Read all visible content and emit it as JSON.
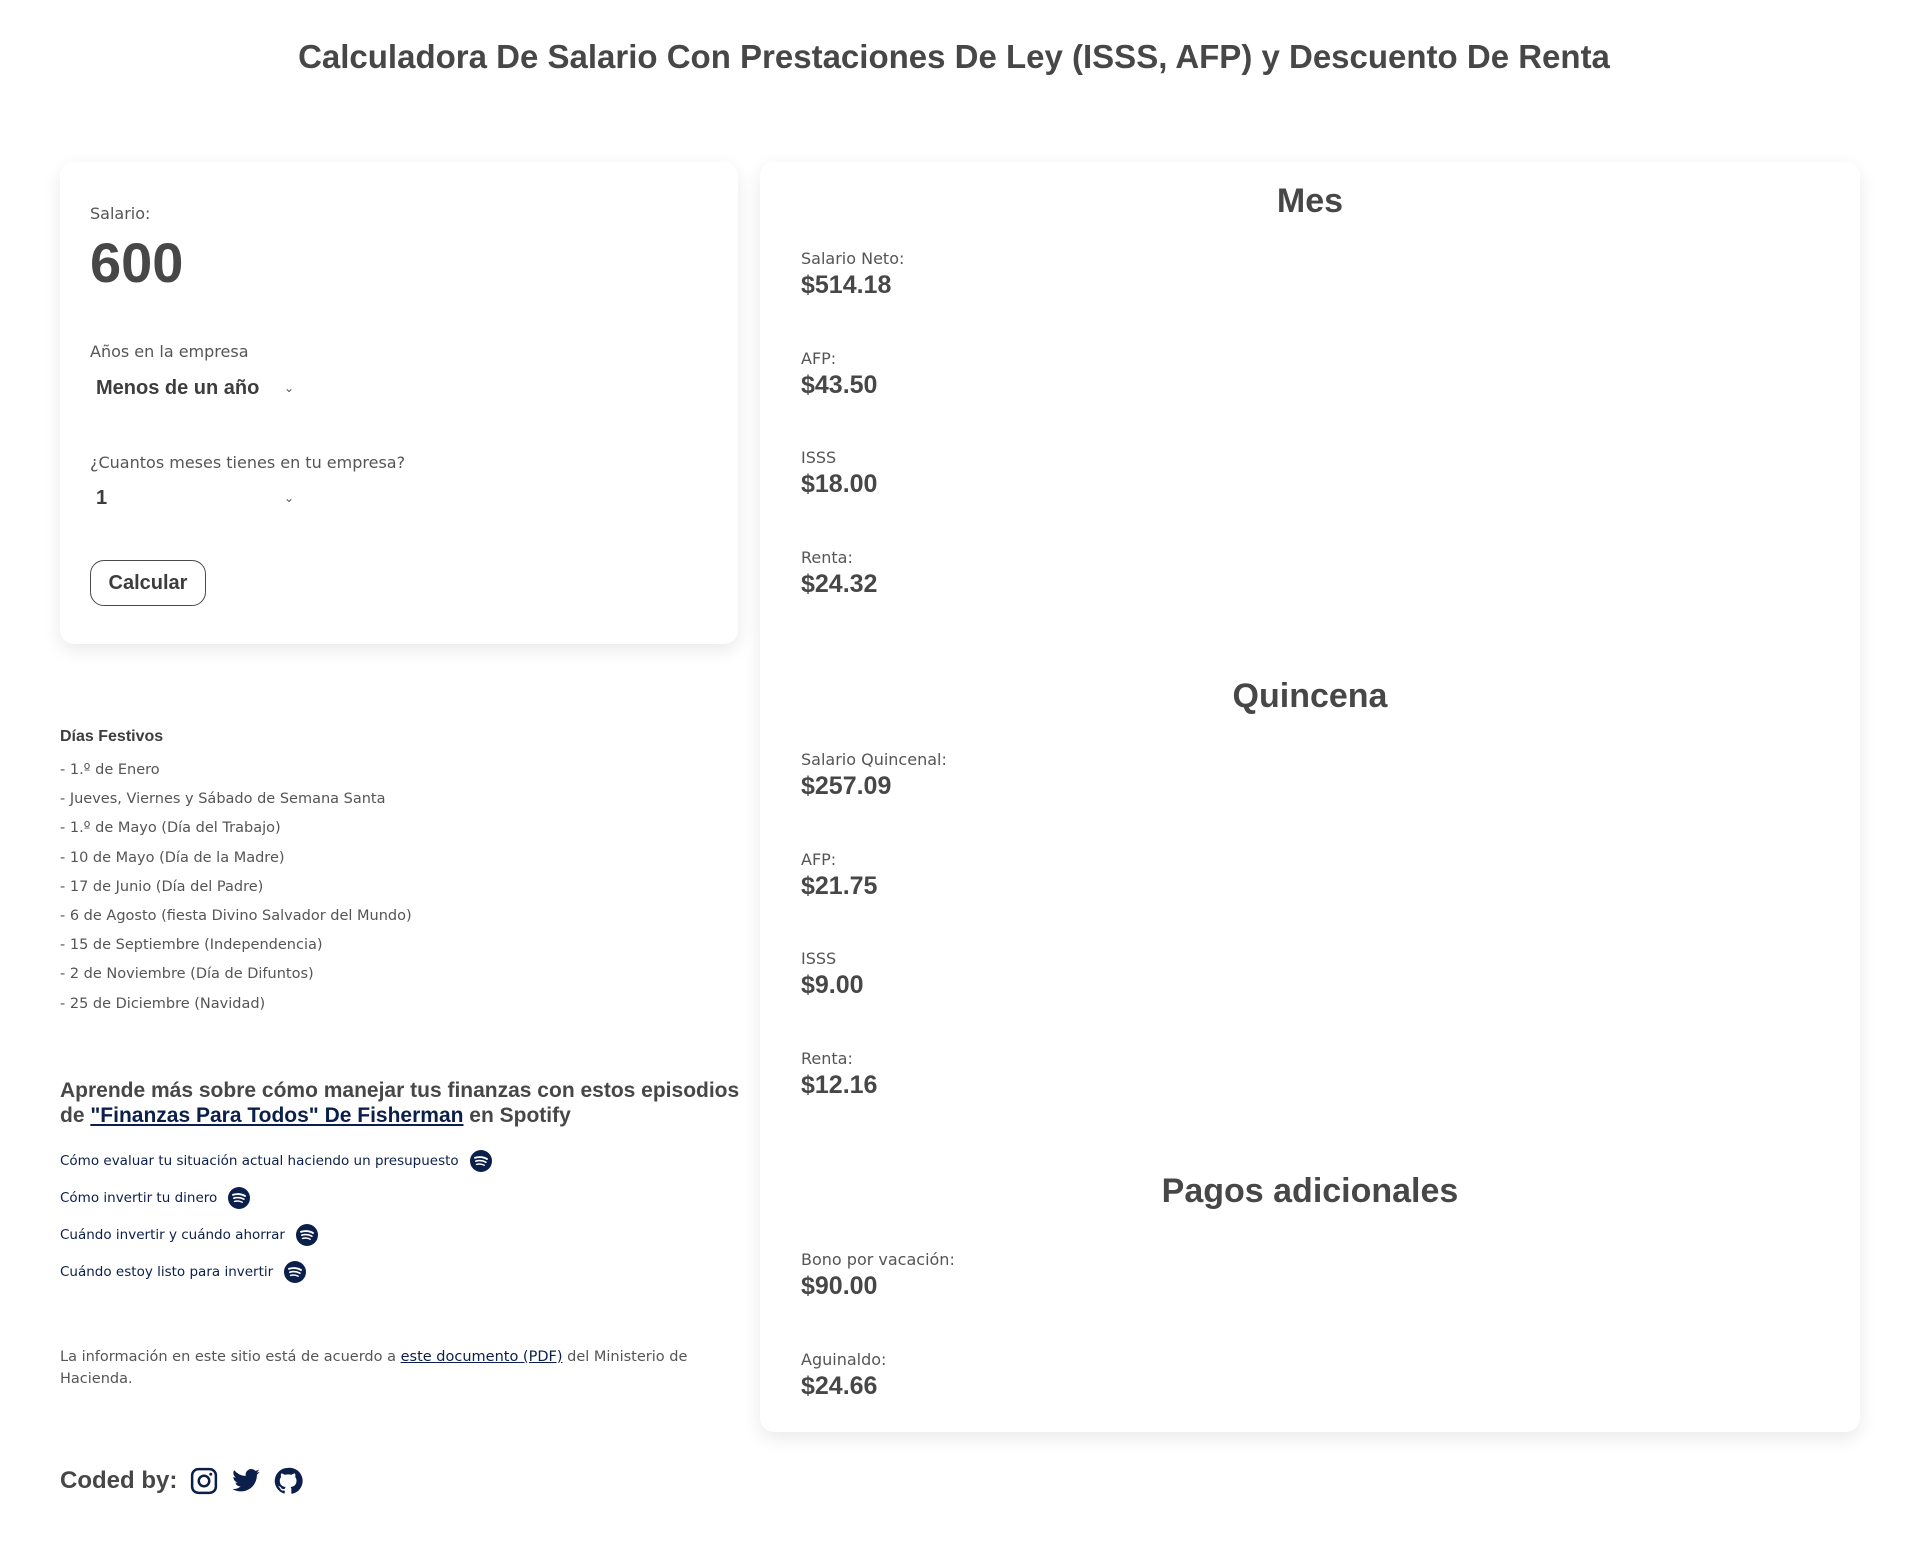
{
  "page": {
    "title": "Calculadora De Salario Con Prestaciones De Ley (ISSS, AFP) y Descuento De Renta"
  },
  "form": {
    "salary_label": "Salario:",
    "salary_value": "600",
    "years_label": "Años en la empresa",
    "years_selected": "Menos de un año",
    "months_label": "¿Cuantos meses tienes en tu empresa?",
    "months_selected": "1",
    "calculate_label": "Calcular"
  },
  "holidays": {
    "title": "Días Festivos",
    "items": [
      "- 1.º de Enero",
      "- Jueves, Viernes y Sábado de Semana Santa",
      "- 1.º de Mayo (Día del Trabajo)",
      "- 10 de Mayo (Día de la Madre)",
      "- 17 de Junio (Día del Padre)",
      "- 6 de Agosto (fiesta Divino Salvador del Mundo)",
      "- 15 de Septiembre (Independencia)",
      "- 2 de Noviembre (Día de Difuntos)",
      "- 25 de Diciembre (Navidad)"
    ]
  },
  "learn": {
    "heading_prefix": "Aprende más sobre cómo manejar tus finanzas con estos episodios de ",
    "podcast_link": "\"Finanzas Para Todos\" De Fisherman",
    "heading_suffix": " en Spotify",
    "episodes": [
      "Cómo evaluar tu situación actual haciendo un presupuesto",
      "Cómo invertir tu dinero",
      "Cuándo invertir y cuándo ahorrar",
      "Cuándo estoy listo para invertir"
    ],
    "episode_icon": "spotify-icon"
  },
  "info": {
    "prefix": "La información en este sitio está de acuerdo a ",
    "link": "este documento (PDF)",
    "suffix": " del Ministerio de Hacienda."
  },
  "footer": {
    "coded_by": "Coded by:",
    "icons": [
      "instagram-icon",
      "twitter-icon",
      "github-icon"
    ]
  },
  "results": {
    "month": {
      "title": "Mes",
      "rows": [
        {
          "label": "Salario Neto:",
          "value": "$514.18"
        },
        {
          "label": "AFP:",
          "value": "$43.50"
        },
        {
          "label": "ISSS",
          "value": "$18.00"
        },
        {
          "label": "Renta:",
          "value": "$24.32"
        }
      ]
    },
    "quincena": {
      "title": "Quincena",
      "rows": [
        {
          "label": "Salario Quincenal:",
          "value": "$257.09"
        },
        {
          "label": "AFP:",
          "value": "$21.75"
        },
        {
          "label": "ISSS",
          "value": "$9.00"
        },
        {
          "label": "Renta:",
          "value": "$12.16"
        }
      ]
    },
    "extra": {
      "title": "Pagos adicionales",
      "rows": [
        {
          "label": "Bono por vacación:",
          "value": "$90.00"
        },
        {
          "label": "Aguinaldo:",
          "value": "$24.66"
        }
      ]
    }
  },
  "colors": {
    "text": "#474747",
    "link": "#0b1f4a",
    "spotify": "#0b1f4a"
  }
}
